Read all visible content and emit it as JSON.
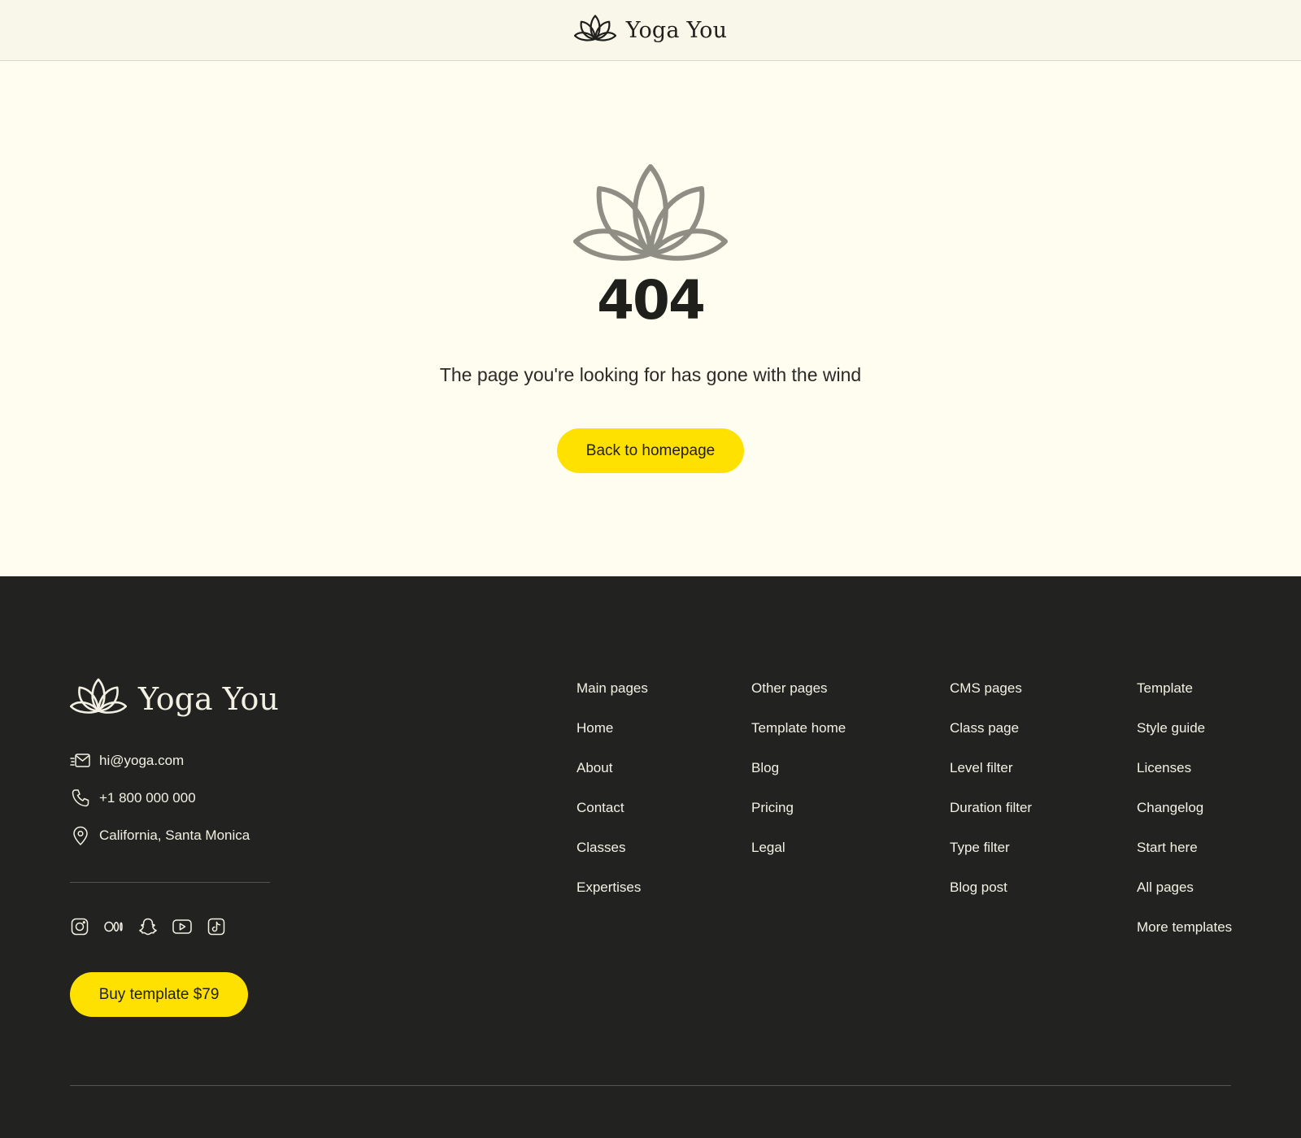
{
  "header": {
    "brand_name": "Yoga You"
  },
  "not_found": {
    "code": "404",
    "message": "The page you're looking for has gone with the wind",
    "button_label": "Back to homepage"
  },
  "footer": {
    "brand_name": "Yoga You",
    "contact": {
      "email": "hi@yoga.com",
      "phone": "+1 800 000 000",
      "address": "California, Santa Monica"
    },
    "socials": [
      "instagram-icon",
      "medium-icon",
      "snapchat-icon",
      "youtube-icon",
      "tiktok-icon"
    ],
    "buy_button_label": "Buy template $79",
    "columns": [
      {
        "heading": "Main pages",
        "links": [
          "Home",
          "About",
          "Contact",
          "Classes",
          "Expertises"
        ]
      },
      {
        "heading": "Other pages",
        "links": [
          "Template home",
          "Blog",
          "Pricing",
          "Legal"
        ]
      },
      {
        "heading": "CMS pages",
        "links": [
          "Class page",
          "Level filter",
          "Duration filter",
          "Type filter",
          "Blog post"
        ]
      },
      {
        "heading": "Template",
        "links": [
          "Style guide",
          "Licenses",
          "Changelog",
          "Start here",
          "All pages",
          "More templates"
        ]
      }
    ]
  },
  "colors": {
    "page_background": "#fffdf0",
    "header_background": "#f9f7ea",
    "footer_background": "#222220",
    "accent_yellow": "#ffe100",
    "text_dark": "#1f1f1b",
    "text_light": "#f3f1e4",
    "lotus_gray": "#8f8e85"
  }
}
